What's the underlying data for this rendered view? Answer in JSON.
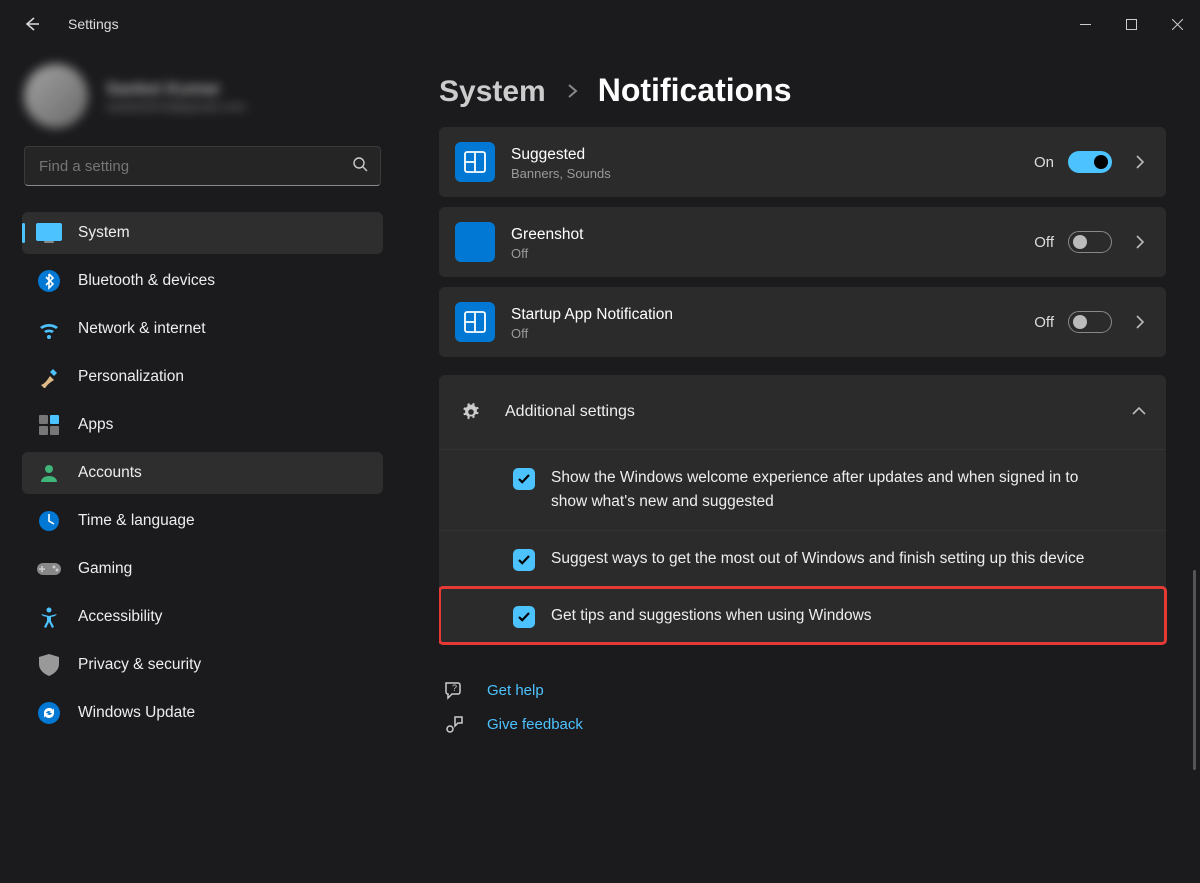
{
  "window": {
    "app_title": "Settings"
  },
  "user": {
    "name": "Sanket Kumar",
    "email": "sanket2019@gmail.com"
  },
  "search": {
    "placeholder": "Find a setting"
  },
  "sidebar": {
    "items": [
      {
        "label": "System"
      },
      {
        "label": "Bluetooth & devices"
      },
      {
        "label": "Network & internet"
      },
      {
        "label": "Personalization"
      },
      {
        "label": "Apps"
      },
      {
        "label": "Accounts"
      },
      {
        "label": "Time & language"
      },
      {
        "label": "Gaming"
      },
      {
        "label": "Accessibility"
      },
      {
        "label": "Privacy & security"
      },
      {
        "label": "Windows Update"
      }
    ]
  },
  "breadcrumb": {
    "parent": "System",
    "current": "Notifications"
  },
  "apps": [
    {
      "title": "Suggested",
      "sub": "Banners, Sounds",
      "state_label": "On",
      "state": "on"
    },
    {
      "title": "Greenshot",
      "sub": "Off",
      "state_label": "Off",
      "state": "off"
    },
    {
      "title": "Startup App Notification",
      "sub": "Off",
      "state_label": "Off",
      "state": "off"
    }
  ],
  "section": {
    "title": "Additional settings"
  },
  "checks": [
    {
      "label": "Show the Windows welcome experience after updates and when signed in to show what's new and suggested"
    },
    {
      "label": "Suggest ways to get the most out of Windows and finish setting up this device"
    },
    {
      "label": "Get tips and suggestions when using Windows"
    }
  ],
  "footer": {
    "help": "Get help",
    "feedback": "Give feedback"
  }
}
